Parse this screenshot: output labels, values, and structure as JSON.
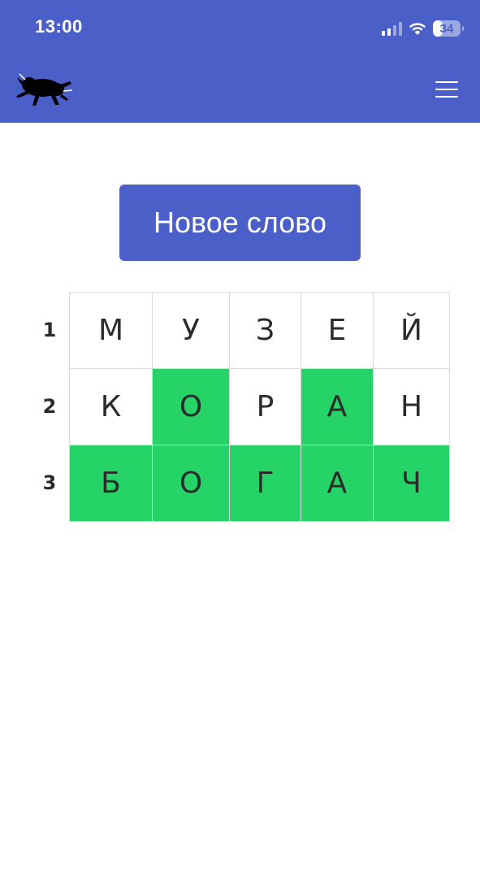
{
  "status_bar": {
    "time": "13:00",
    "battery": "34",
    "battery_level": 0.34
  },
  "header": {
    "logo_icon": "bull-logo-icon",
    "menu_icon": "hamburger-menu-icon"
  },
  "main": {
    "new_word_label": "Новое слово"
  },
  "board": {
    "rows": [
      {
        "number": "1",
        "cells": [
          {
            "letter": "М",
            "state": "none"
          },
          {
            "letter": "У",
            "state": "none"
          },
          {
            "letter": "З",
            "state": "none"
          },
          {
            "letter": "Е",
            "state": "none"
          },
          {
            "letter": "Й",
            "state": "none"
          }
        ]
      },
      {
        "number": "2",
        "cells": [
          {
            "letter": "К",
            "state": "none"
          },
          {
            "letter": "О",
            "state": "correct"
          },
          {
            "letter": "Р",
            "state": "none"
          },
          {
            "letter": "А",
            "state": "correct"
          },
          {
            "letter": "Н",
            "state": "none"
          }
        ]
      },
      {
        "number": "3",
        "cells": [
          {
            "letter": "Б",
            "state": "correct"
          },
          {
            "letter": "О",
            "state": "correct"
          },
          {
            "letter": "Г",
            "state": "correct"
          },
          {
            "letter": "А",
            "state": "correct"
          },
          {
            "letter": "Ч",
            "state": "correct"
          }
        ]
      }
    ]
  },
  "colors": {
    "brand": "#4a60c8",
    "correct": "#26d366",
    "text": "#2b2b2b",
    "grid_border": "#d9d9d9"
  }
}
